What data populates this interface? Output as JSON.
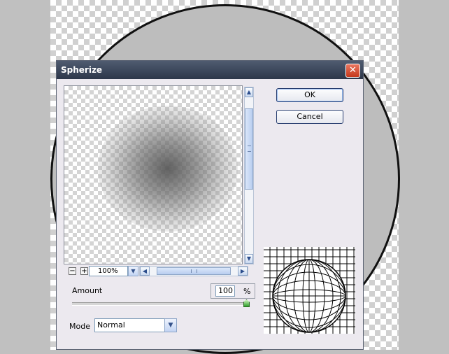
{
  "dialog": {
    "title": "Spherize",
    "close_glyph": "✕"
  },
  "buttons": {
    "ok": "OK",
    "cancel": "Cancel"
  },
  "zoom": {
    "minus": "−",
    "plus": "+",
    "value": "100%"
  },
  "amount": {
    "label": "Amount",
    "value": "100",
    "unit": "%",
    "slider_fraction": 1.0
  },
  "mode": {
    "label": "Mode",
    "value": "Normal"
  },
  "icons": [
    "close-icon",
    "scroll-up-arrow-icon",
    "scroll-down-arrow-icon",
    "scroll-left-arrow-icon",
    "scroll-right-arrow-icon",
    "chevron-down-icon",
    "zoom-out-icon",
    "zoom-in-icon",
    "slider-thumb-icon"
  ],
  "colors": {
    "title_bar": "#2d374a",
    "dialog_bg": "#ece9ef",
    "close_button": "#c5391c",
    "slider_thumb": "#2fa12a"
  }
}
